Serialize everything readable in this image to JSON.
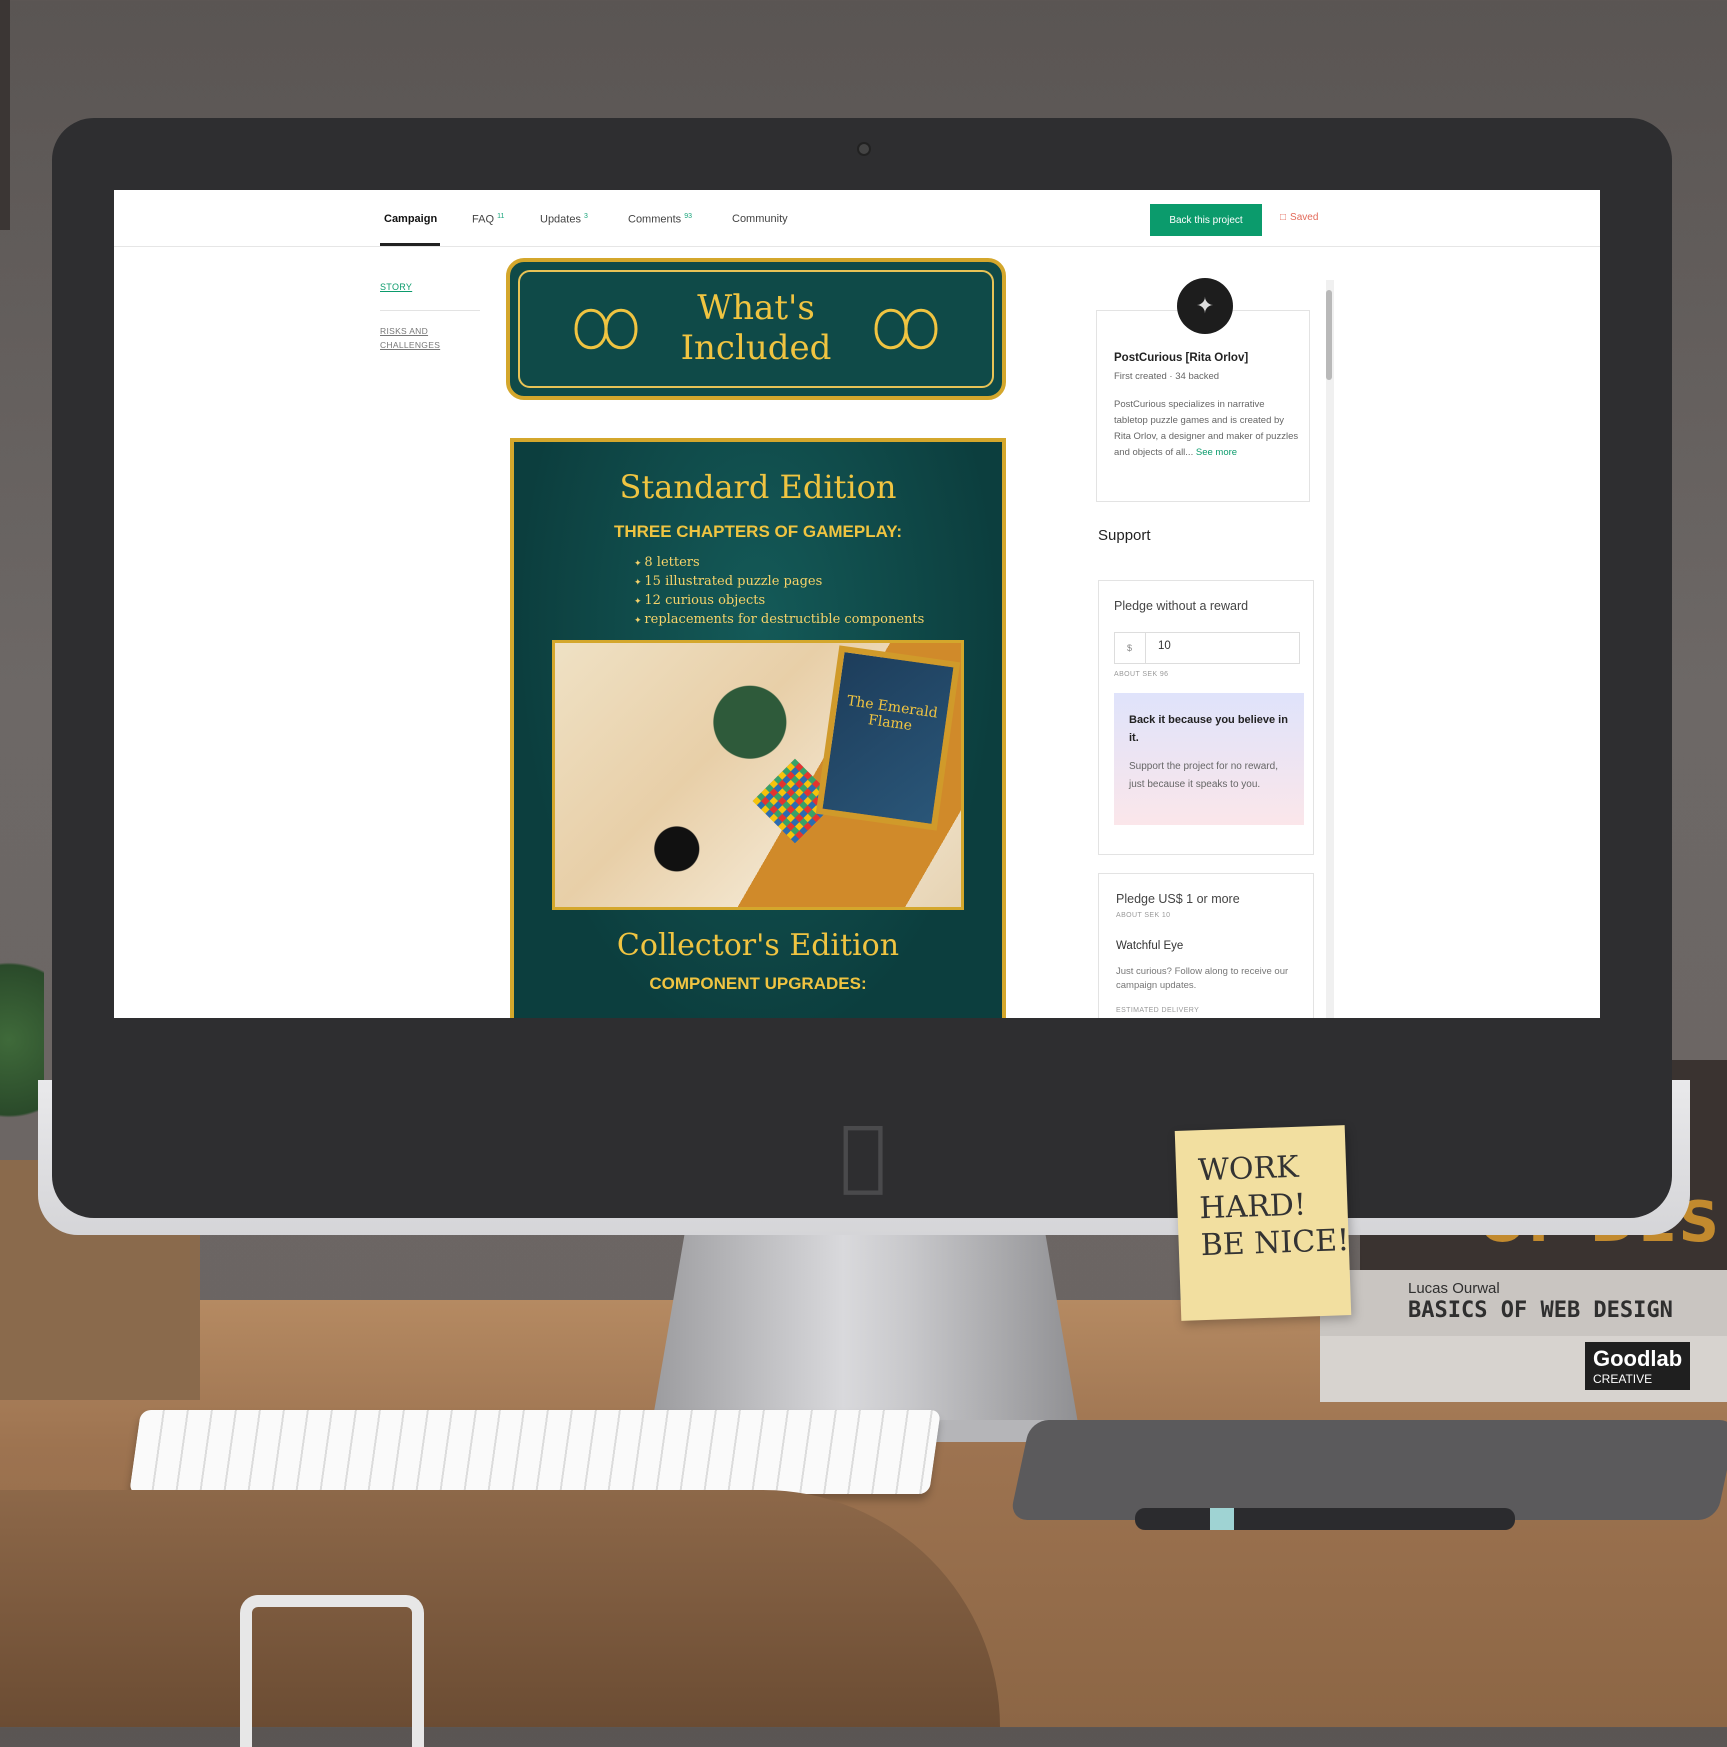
{
  "nav": {
    "tabs": [
      {
        "label": "Campaign",
        "count": ""
      },
      {
        "label": "FAQ",
        "count": "11"
      },
      {
        "label": "Updates",
        "count": "3"
      },
      {
        "label": "Comments",
        "count": "93"
      },
      {
        "label": "Community",
        "count": ""
      }
    ],
    "back_button": "Back this project",
    "saved_label": "Saved"
  },
  "sidebar": {
    "story": "STORY",
    "risks": "RISKS AND CHALLENGES"
  },
  "banner": {
    "title_line1": "What's",
    "title_line2": "Included"
  },
  "poster": {
    "standard_title": "Standard Edition",
    "gameplay_heading": "THREE CHAPTERS OF GAMEPLAY:",
    "items": [
      "8 letters",
      "15 illustrated puzzle pages",
      "12 curious objects",
      "replacements for destructible components"
    ],
    "book_title": "The Emerald Flame",
    "collector_title": "Collector's Edition",
    "upgrades_heading": "COMPONENT UPGRADES:"
  },
  "creator": {
    "name": "PostCurious [Rita Orlov]",
    "meta": "First created · 34 backed",
    "bio": "PostCurious specializes in narrative tabletop puzzle games and is created by Rita Orlov, a designer and maker of puzzles and objects of all...",
    "see_more": "See more"
  },
  "support": {
    "heading": "Support",
    "pledge_title": "Pledge without a reward",
    "currency": "$",
    "amount": "10",
    "about": "ABOUT SEK 96",
    "promo_title": "Back it because you believe in it.",
    "promo_body": "Support the project for no reward, just because it speaks to you."
  },
  "reward": {
    "title": "Pledge US$ 1 or more",
    "about": "ABOUT SEK 10",
    "name": "Watchful Eye",
    "desc": "Just curious? Follow along to receive our campaign updates.",
    "delivery": "ESTIMATED DELIVERY"
  },
  "desk": {
    "sticky_line1": "WORK",
    "sticky_line2": "HARD!",
    "sticky_line3": "BE NICE!",
    "book_top": "OF DES",
    "book_author": "Lucas Ourwal",
    "book_title": "BASICS OF WEB DESIGN",
    "brand": "Goodlab",
    "brand_sub": "CREATIVE"
  },
  "colors": {
    "accent": "#0b9b6c",
    "saved": "#e36a5a",
    "poster_bg": "#0f4a48",
    "gold": "#d4a72c"
  }
}
